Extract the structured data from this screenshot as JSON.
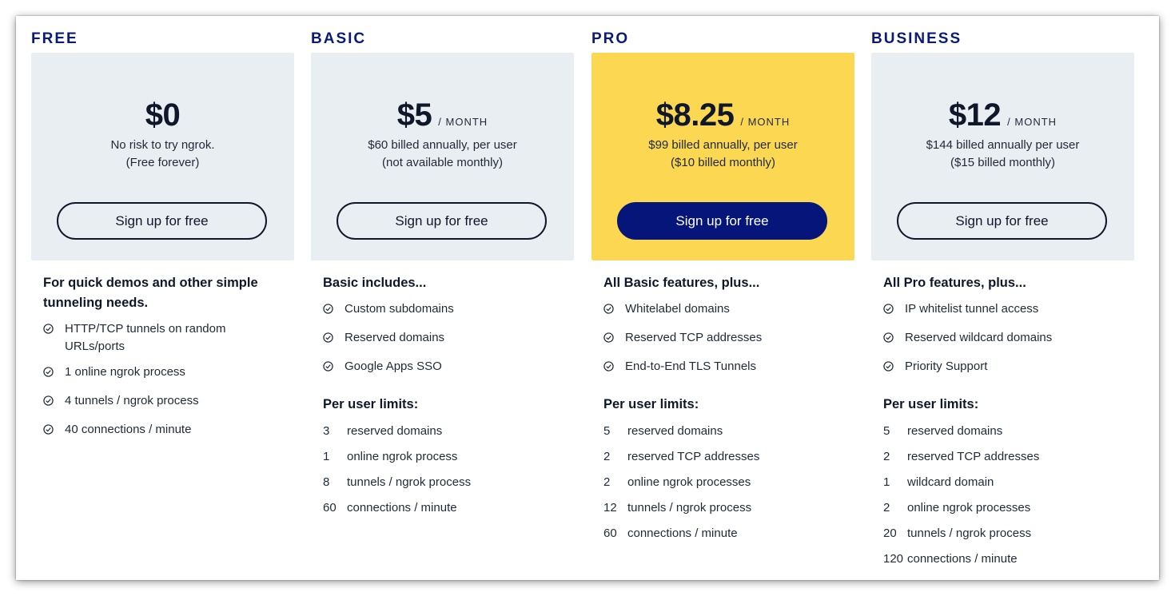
{
  "plans": [
    {
      "name": "FREE",
      "price": "$0",
      "period": "",
      "note_line1": "No risk to try ngrok.",
      "note_line2": "(Free forever)",
      "button": "Sign up for free",
      "heading_line1": "For quick demos and other simple",
      "heading_line2": "tunneling needs.",
      "features": [
        {
          "line1": "HTTP/TCP tunnels on random",
          "line2": "URLs/ports"
        },
        {
          "line1": "1 online ngrok process",
          "line2": ""
        },
        {
          "line1": "4 tunnels / ngrok process",
          "line2": ""
        },
        {
          "line1": "40 connections / minute",
          "line2": ""
        }
      ],
      "limits_heading": "",
      "limits": []
    },
    {
      "name": "BASIC",
      "price": "$5",
      "period": "/ MONTH",
      "note_line1": "$60 billed annually, per user",
      "note_line2": "(not available monthly)",
      "button": "Sign up for free",
      "heading_line1": "Basic includes...",
      "heading_line2": "",
      "features": [
        {
          "line1": "Custom subdomains",
          "line2": ""
        },
        {
          "line1": "Reserved domains",
          "line2": ""
        },
        {
          "line1": "Google Apps SSO",
          "line2": ""
        }
      ],
      "limits_heading": "Per user limits:",
      "limits": [
        {
          "num": "3",
          "label": "reserved domains"
        },
        {
          "num": "1",
          "label": "online ngrok process"
        },
        {
          "num": "8",
          "label": "tunnels / ngrok process"
        },
        {
          "num": "60",
          "label": "connections / minute"
        }
      ]
    },
    {
      "name": "PRO",
      "price": "$8.25",
      "period": "/ MONTH",
      "note_line1": "$99 billed annually, per user",
      "note_line2": "($10 billed monthly)",
      "button": "Sign up for free",
      "heading_line1": "All Basic features, plus...",
      "heading_line2": "",
      "features": [
        {
          "line1": "Whitelabel domains",
          "line2": ""
        },
        {
          "line1": "Reserved TCP addresses",
          "line2": ""
        },
        {
          "line1": "End-to-End TLS Tunnels",
          "line2": ""
        }
      ],
      "limits_heading": "Per user limits:",
      "limits": [
        {
          "num": "5",
          "label": "reserved domains"
        },
        {
          "num": "2",
          "label": "reserved TCP addresses"
        },
        {
          "num": "2",
          "label": "online ngrok processes"
        },
        {
          "num": "12",
          "label": "tunnels / ngrok process"
        },
        {
          "num": "60",
          "label": "connections / minute"
        }
      ]
    },
    {
      "name": "BUSINESS",
      "price": "$12",
      "period": "/ MONTH",
      "note_line1": "$144 billed annually per user",
      "note_line2": "($15 billed monthly)",
      "button": "Sign up for free",
      "heading_line1": "All Pro features, plus...",
      "heading_line2": "",
      "features": [
        {
          "line1": "IP whitelist tunnel access",
          "line2": ""
        },
        {
          "line1": "Reserved wildcard domains",
          "line2": ""
        },
        {
          "line1": "Priority Support",
          "line2": ""
        }
      ],
      "limits_heading": "Per user limits:",
      "limits": [
        {
          "num": "5",
          "label": "reserved domains"
        },
        {
          "num": "2",
          "label": "reserved TCP addresses"
        },
        {
          "num": "1",
          "label": "wildcard domain"
        },
        {
          "num": "2",
          "label": "online ngrok processes"
        },
        {
          "num": "20",
          "label": "tunnels / ngrok process"
        },
        {
          "num": "120",
          "label": "connections / minute"
        }
      ]
    }
  ],
  "colors": {
    "tier_name": "#0a1a7a",
    "card": "#e9eef2",
    "card_highlight": "#fbd752",
    "primary_button": "#06157a"
  },
  "icons": {
    "feature": "check-circle-icon"
  }
}
